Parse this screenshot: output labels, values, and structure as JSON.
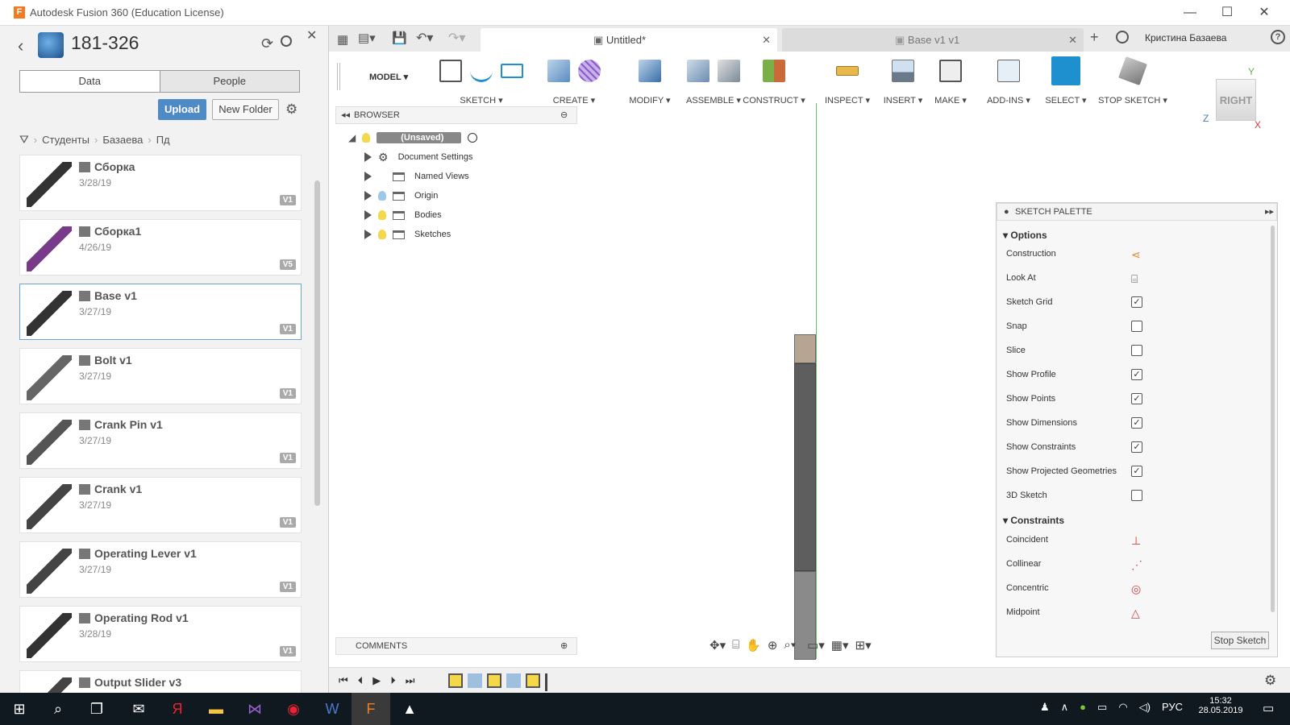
{
  "window": {
    "title": "Autodesk Fusion 360 (Education License)",
    "logo_letter": "F",
    "minimize": "—",
    "maximize": "☐",
    "close": "✕"
  },
  "data_panel": {
    "project_title": "181-326",
    "tabs": [
      "Data",
      "People"
    ],
    "upload_label": "Upload",
    "new_folder_label": "New Folder",
    "breadcrumb": [
      "Студенты",
      "Базаева",
      "Пд"
    ],
    "files": [
      {
        "name": "Сборка",
        "date": "3/28/19",
        "version": "V1",
        "color": "#333"
      },
      {
        "name": "Сборка1",
        "date": "4/26/19",
        "version": "V5",
        "color": "#7a3a8a"
      },
      {
        "name": "Base v1",
        "date": "3/27/19",
        "version": "V1",
        "color": "#333"
      },
      {
        "name": "Bolt v1",
        "date": "3/27/19",
        "version": "V1",
        "color": "#666"
      },
      {
        "name": "Crank Pin v1",
        "date": "3/27/19",
        "version": "V1",
        "color": "#555"
      },
      {
        "name": "Crank v1",
        "date": "3/27/19",
        "version": "V1",
        "color": "#444"
      },
      {
        "name": "Operating Lever v1",
        "date": "3/27/19",
        "version": "V1",
        "color": "#444"
      },
      {
        "name": "Operating Rod v1",
        "date": "3/28/19",
        "version": "V1",
        "color": "#333"
      },
      {
        "name": "Output Slider v3",
        "date": "",
        "version": "",
        "color": "#444"
      }
    ]
  },
  "document_tabs": [
    {
      "label": "Untitled*",
      "active": true
    },
    {
      "label": "Base v1 v1",
      "active": false
    }
  ],
  "user_name": "Кристина Базаева",
  "toolbar": {
    "workspace": "MODEL",
    "groups": [
      "SKETCH",
      "CREATE",
      "MODIFY",
      "ASSEMBLE",
      "CONSTRUCT",
      "INSPECT",
      "INSERT",
      "MAKE",
      "ADD-INS",
      "SELECT",
      "STOP SKETCH"
    ]
  },
  "viewcube": {
    "face": "RIGHT",
    "axis_y": "Y",
    "axis_z": "Z",
    "axis_x": "X"
  },
  "browser": {
    "header": "BROWSER",
    "root": "(Unsaved)",
    "items": [
      "Document Settings",
      "Named Views",
      "Origin",
      "Bodies",
      "Sketches"
    ]
  },
  "comments_label": "COMMENTS",
  "sketch_palette": {
    "title": "SKETCH PALETTE",
    "options_header": "Options",
    "options": [
      {
        "label": "Construction",
        "type": "icon"
      },
      {
        "label": "Look At",
        "type": "icon"
      },
      {
        "label": "Sketch Grid",
        "type": "check",
        "checked": true
      },
      {
        "label": "Snap",
        "type": "check",
        "checked": false
      },
      {
        "label": "Slice",
        "type": "check",
        "checked": false
      },
      {
        "label": "Show Profile",
        "type": "check",
        "checked": true
      },
      {
        "label": "Show Points",
        "type": "check",
        "checked": true
      },
      {
        "label": "Show Dimensions",
        "type": "check",
        "checked": true
      },
      {
        "label": "Show Constraints",
        "type": "check",
        "checked": true
      },
      {
        "label": "Show Projected Geometries",
        "type": "check",
        "checked": true
      },
      {
        "label": "3D Sketch",
        "type": "check",
        "checked": false
      }
    ],
    "constraints_header": "Constraints",
    "constraints": [
      "Coincident",
      "Collinear",
      "Concentric",
      "Midpoint"
    ],
    "stop_sketch": "Stop Sketch"
  },
  "taskbar": {
    "language": "РУС",
    "time": "15:32",
    "date": "28.05.2019"
  },
  "colors": {
    "accent": "#4d8ac6",
    "select_tool": "#1e90d0",
    "brand": "#f37a20"
  }
}
